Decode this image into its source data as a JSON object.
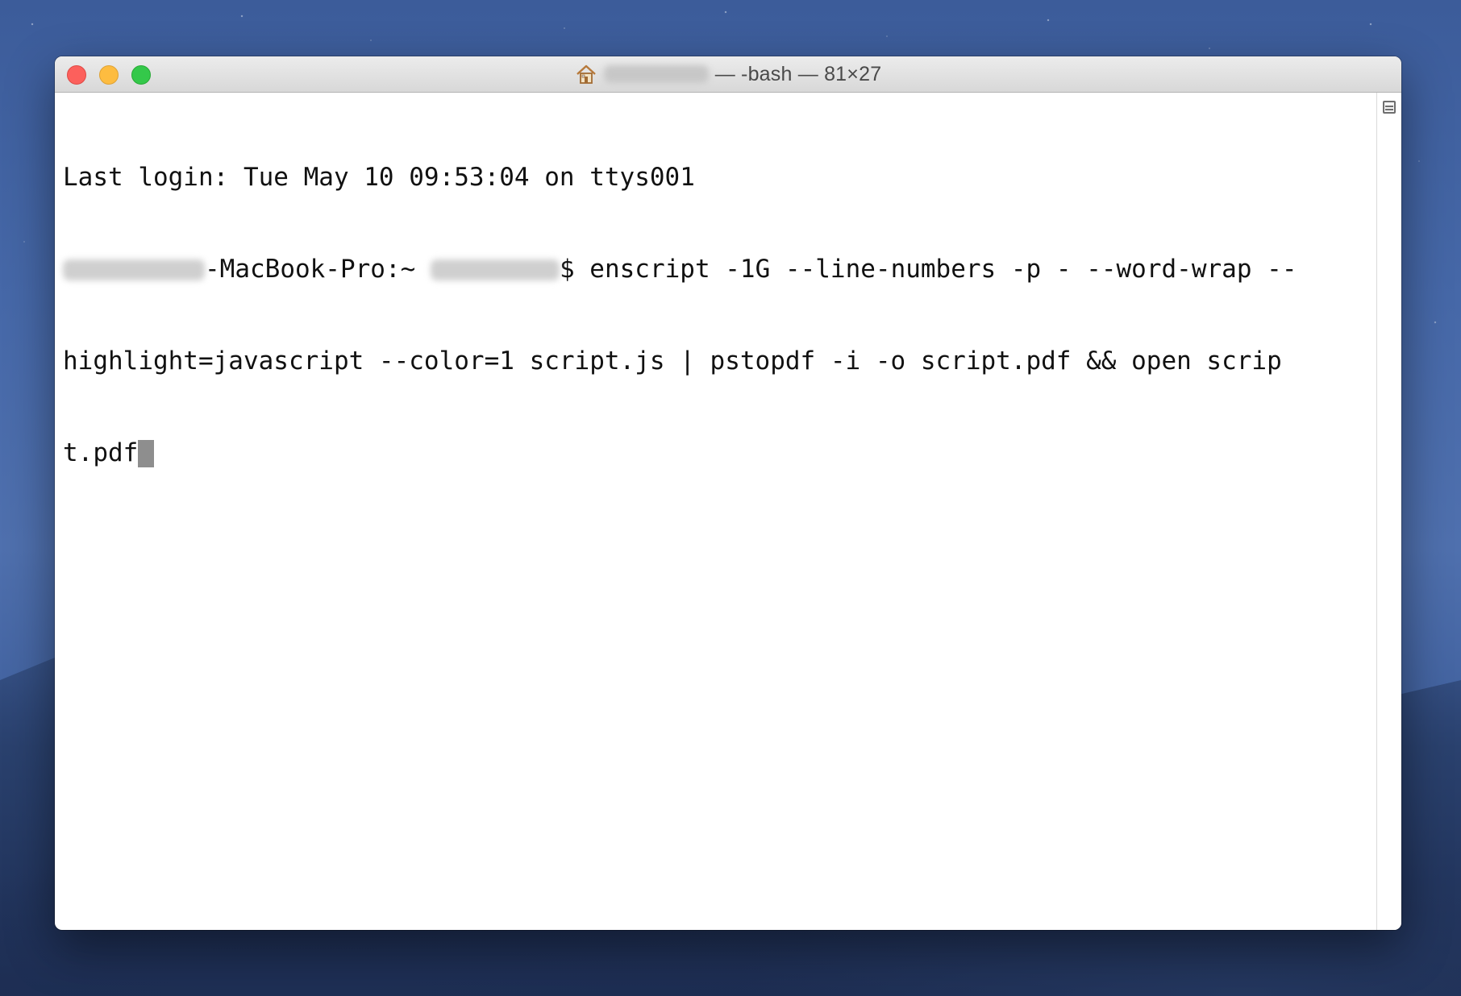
{
  "window": {
    "title": "— -bash — 81×27",
    "icon": "home-icon"
  },
  "colors": {
    "close": "#fc605c",
    "minimize": "#fdbc40",
    "zoom": "#34c84a",
    "cursor": "#8e8e8e"
  },
  "terminal": {
    "lines": [
      "Last login: Tue May 10 09:53:04 on ttys001",
      "-MacBook-Pro:~ ",
      "$ enscript -1G --line-numbers -p - --word-wrap --",
      "highlight=javascript --color=1 script.js | pstopdf -i -o script.pdf && open scrip",
      "t.pdf"
    ]
  }
}
